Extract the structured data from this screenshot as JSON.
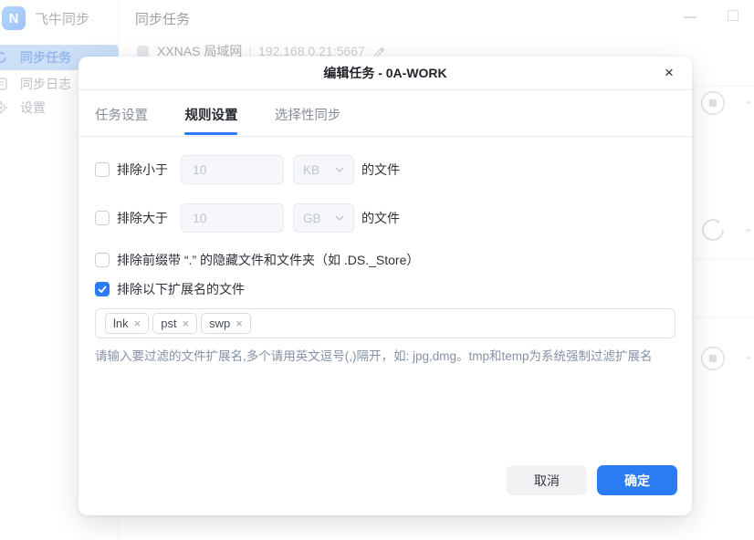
{
  "window": {
    "app_title": "飞牛同步",
    "page_title": "同步任务"
  },
  "sidebar": {
    "items": [
      {
        "label": "同步任务",
        "active": true
      },
      {
        "label": "同步日志",
        "active": false
      },
      {
        "label": "设置",
        "active": false
      }
    ]
  },
  "background": {
    "device": {
      "name": "XXNAS 局域网",
      "separator": "|",
      "address": "192.168.0.21:5667"
    }
  },
  "modal": {
    "title": "编辑任务 - 0A-WORK",
    "tabs": [
      {
        "label": "任务设置"
      },
      {
        "label": "规则设置"
      },
      {
        "label": "选择性同步"
      }
    ],
    "active_tab": "规则设置",
    "rules": {
      "size_min": {
        "label": "排除小于",
        "placeholder": "10",
        "unit": "KB",
        "suffix": "的文件",
        "checked": false
      },
      "size_max": {
        "label": "排除大于",
        "placeholder": "10",
        "unit": "GB",
        "suffix": "的文件",
        "checked": false
      },
      "hidden_files": {
        "label": "排除前缀带 “.” 的隐藏文件和文件夹（如 .DS._Store）",
        "checked": false
      },
      "extensions": {
        "label": "排除以下扩展名的文件",
        "checked": true
      }
    },
    "extension_tags": [
      "lnk",
      "pst",
      "swp"
    ],
    "helper_text": "请输入要过滤的文件扩展名,多个请用英文逗号(,)隔开，如: jpg,dmg。tmp和temp为系统强制过滤扩展名",
    "buttons": {
      "cancel": "取消",
      "confirm": "确定"
    }
  },
  "icons": {
    "close": "×",
    "tag_remove": "×",
    "logo_letter": "N"
  },
  "colors": {
    "accent": "#2b7bf3",
    "sidebar_active_bg": "#8db9ee",
    "disabled_input_bg": "#f5f7fa",
    "helper_text": "#8592a6"
  }
}
